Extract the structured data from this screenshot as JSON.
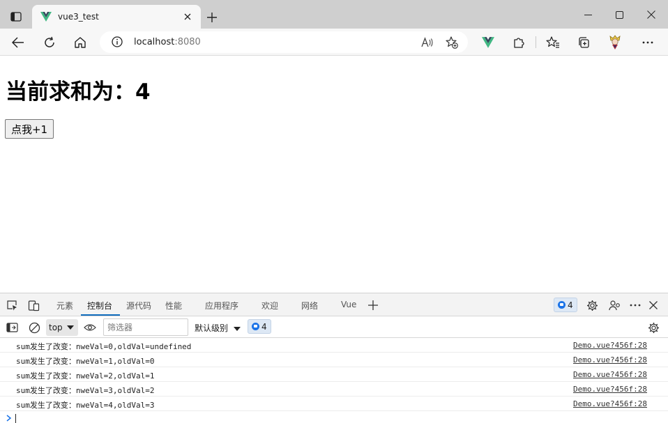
{
  "browser": {
    "tab": {
      "title": "vue3_test"
    },
    "address": {
      "host": "localhost",
      "port": ":8080"
    }
  },
  "page": {
    "heading": "当前求和为：4",
    "button_label": "点我+1"
  },
  "devtools": {
    "tabs": [
      {
        "label": "元素",
        "active": false
      },
      {
        "label": "控制台",
        "active": true
      },
      {
        "label": "源代码",
        "active": false
      },
      {
        "label": "性能",
        "active": false
      },
      {
        "label": "应用程序",
        "active": false
      },
      {
        "label": "欢迎",
        "active": false
      },
      {
        "label": "网络",
        "active": false
      },
      {
        "label": "Vue",
        "active": false
      }
    ],
    "message_count": "4",
    "context": "top",
    "filter_placeholder": "筛选器",
    "levels_label": "默认级别",
    "console_messages": [
      {
        "text": "sum发生了改变：nweVal=0,oldVal=undefined",
        "source": "Demo.vue?456f:28"
      },
      {
        "text": "sum发生了改变：nweVal=1,oldVal=0",
        "source": "Demo.vue?456f:28"
      },
      {
        "text": "sum发生了改变：nweVal=2,oldVal=1",
        "source": "Demo.vue?456f:28"
      },
      {
        "text": "sum发生了改变：nweVal=3,oldVal=2",
        "source": "Demo.vue?456f:28"
      },
      {
        "text": "sum发生了改变：nweVal=4,oldVal=3",
        "source": "Demo.vue?456f:28"
      }
    ]
  },
  "colors": {
    "vue_green": "#41b883",
    "vue_dark": "#35495e",
    "active_tab_underline": "#0f6cbd",
    "badge_blue": "#1a73e8"
  }
}
